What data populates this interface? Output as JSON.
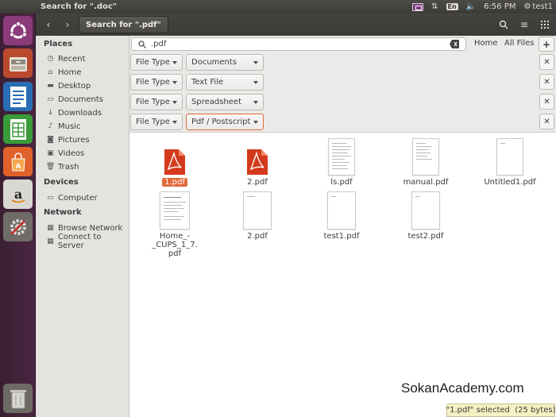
{
  "top_panel": {
    "window_title": "Search for \".doc\"",
    "keyboard_layout": "En",
    "clock": "6:56 PM",
    "user": "test1"
  },
  "header": {
    "path_label": "Search for \".pdf\""
  },
  "sidebar": {
    "places_heading": "Places",
    "places": [
      {
        "label": "Recent",
        "icon": "clock-icon"
      },
      {
        "label": "Home",
        "icon": "home-icon"
      },
      {
        "label": "Desktop",
        "icon": "folder-icon"
      },
      {
        "label": "Documents",
        "icon": "folder-icon"
      },
      {
        "label": "Downloads",
        "icon": "download-icon"
      },
      {
        "label": "Music",
        "icon": "music-icon"
      },
      {
        "label": "Pictures",
        "icon": "camera-icon"
      },
      {
        "label": "Videos",
        "icon": "film-icon"
      },
      {
        "label": "Trash",
        "icon": "trash-icon"
      }
    ],
    "devices_heading": "Devices",
    "devices": [
      {
        "label": "Computer",
        "icon": "drive-icon"
      }
    ],
    "network_heading": "Network",
    "network": [
      {
        "label": "Browse Network",
        "icon": "network-icon"
      },
      {
        "label": "Connect to Server",
        "icon": "server-icon"
      }
    ]
  },
  "search": {
    "query": ".pdf",
    "scope_home": "Home",
    "scope_all": "All Files",
    "criteria": [
      {
        "type": "File Type",
        "value": "Documents",
        "active": false
      },
      {
        "type": "File Type",
        "value": "Text File",
        "active": false
      },
      {
        "type": "File Type",
        "value": "Spreadsheet",
        "active": false
      },
      {
        "type": "File Type",
        "value": "Pdf / Postscript",
        "active": true
      }
    ]
  },
  "files": [
    {
      "name": "1.pdf",
      "kind": "pdf-icon",
      "selected": true
    },
    {
      "name": "2.pdf",
      "kind": "pdf-icon",
      "selected": false
    },
    {
      "name": "ls.pdf",
      "kind": "thumb",
      "selected": false
    },
    {
      "name": "manual.pdf",
      "kind": "thumb",
      "selected": false
    },
    {
      "name": "Untitled1.pdf",
      "kind": "thumb",
      "selected": false
    },
    {
      "name": "Home_-_CUPS_1_7.\npdf",
      "kind": "thumb",
      "selected": false
    },
    {
      "name": "2.pdf",
      "kind": "thumb",
      "selected": false
    },
    {
      "name": "test1.pdf",
      "kind": "thumb",
      "selected": false
    },
    {
      "name": "test2.pdf",
      "kind": "thumb",
      "selected": false
    }
  ],
  "status": "\"1.pdf\" selected  (25 bytes)",
  "watermark": "SokanAcademy.com",
  "colors": {
    "accent": "#e26a3c",
    "launcher": "#4a2541",
    "panel": "#3c3b37"
  }
}
